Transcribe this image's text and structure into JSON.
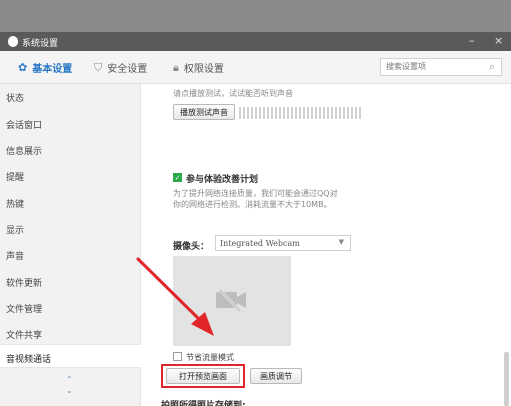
{
  "window": {
    "title": "系统设置",
    "minimize": "–",
    "close": "×"
  },
  "tabs": [
    {
      "label": "基本设置",
      "icon": "gear-icon"
    },
    {
      "label": "安全设置",
      "icon": "shield-icon"
    },
    {
      "label": "权限设置",
      "icon": "lock-icon"
    }
  ],
  "search": {
    "placeholder": "搜索设置项"
  },
  "sidebar": {
    "items": [
      {
        "label": "状态"
      },
      {
        "label": "会话窗口"
      },
      {
        "label": "信息展示"
      },
      {
        "label": "提醒"
      },
      {
        "label": "热键"
      },
      {
        "label": "显示"
      },
      {
        "label": "声音"
      },
      {
        "label": "软件更新"
      },
      {
        "label": "文件管理"
      },
      {
        "label": "文件共享"
      },
      {
        "label": "音视频通话"
      }
    ],
    "up_arrow": "⌃",
    "down_arrow": "⌄"
  },
  "content": {
    "hint": "请点播放测试，试试能否听到声音",
    "play_test_button": "播放测试声音",
    "plan_label": "参与体验改善计划",
    "plan_desc_1": "为了提升网络连接质量，我们可能会通过QQ对",
    "plan_desc_2": "你的网络进行检测。消耗流量不大于10MB。",
    "camera_label": "摄像头：",
    "camera_value": "Integrated Webcam",
    "lowlight_label": "节省流量模式",
    "open_preview_button": "打开预览画面",
    "quality_button": "画质调节",
    "save_photo_label": "拍照所得照片存储到:"
  },
  "colors": {
    "accent": "#2b78c8",
    "annotation": "#e0262b",
    "check": "#2ba84a"
  }
}
